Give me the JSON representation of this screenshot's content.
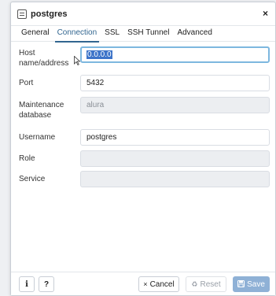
{
  "dialog": {
    "title": "postgres",
    "close_glyph": "×"
  },
  "tabs": [
    {
      "label": "General"
    },
    {
      "label": "Connection"
    },
    {
      "label": "SSL"
    },
    {
      "label": "SSH Tunnel"
    },
    {
      "label": "Advanced"
    }
  ],
  "active_tab": "Connection",
  "form": {
    "host": {
      "label_line1": "Host",
      "label_line2": "name/address",
      "value": "0.0.0.0"
    },
    "port": {
      "label": "Port",
      "value": "5432"
    },
    "maintenance_db": {
      "label_line1": "Maintenance",
      "label_line2": "database",
      "value": "alura"
    },
    "username": {
      "label": "Username",
      "value": "postgres"
    },
    "role": {
      "label": "Role",
      "value": ""
    },
    "service": {
      "label": "Service",
      "value": ""
    }
  },
  "footer": {
    "info_glyph": "i",
    "help_glyph": "?",
    "cancel_label": "Cancel",
    "cancel_icon": "×",
    "reset_label": "Reset",
    "reset_icon": "♻",
    "save_label": "Save",
    "save_icon": "💾"
  },
  "colors": {
    "accent": "#326690",
    "save_bg": "#8fb1d6",
    "selection": "#3d74c9",
    "focus_border": "#7db7df"
  }
}
